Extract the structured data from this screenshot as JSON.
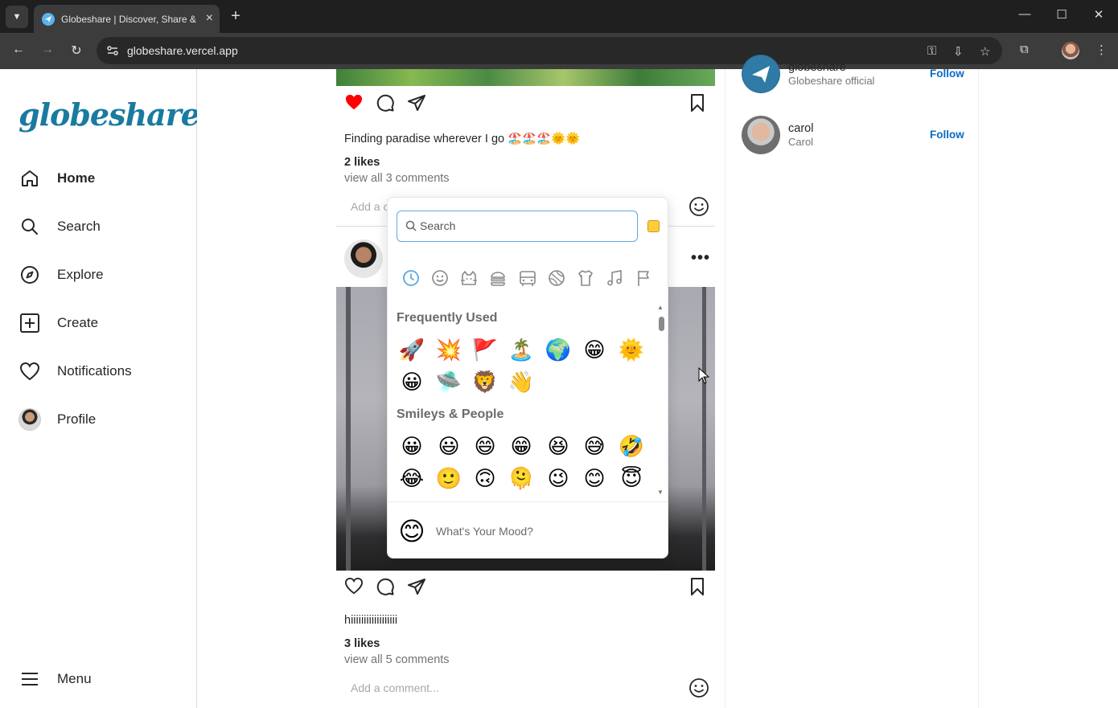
{
  "browser": {
    "tab_title": "Globeshare | Discover, Share & Connect",
    "url": "globeshare.vercel.app"
  },
  "sidebar": {
    "logo": "globeshare",
    "items": [
      {
        "label": "Home",
        "icon": "home-icon"
      },
      {
        "label": "Search",
        "icon": "search-icon"
      },
      {
        "label": "Explore",
        "icon": "compass-icon"
      },
      {
        "label": "Create",
        "icon": "plus-square-icon"
      },
      {
        "label": "Notifications",
        "icon": "heart-icon"
      },
      {
        "label": "Profile",
        "icon": "avatar"
      }
    ],
    "menu_label": "Menu"
  },
  "post1": {
    "caption": "Finding paradise wherever I go 🏖️🏖️🏖️🌞🌞",
    "likes": "2 likes",
    "comments_link": "view all 3 comments",
    "add_comment_placeholder": "Add a comment..."
  },
  "post2": {
    "caption": "hiiiiiiiiiiiiiiiiii",
    "likes": "3 likes",
    "comments_link": "view all 5 comments",
    "add_comment_placeholder": "Add a comment..."
  },
  "suggestions": [
    {
      "name": "globeshare",
      "sub": "Globeshare official",
      "follow": "Follow"
    },
    {
      "name": "carol",
      "sub": "Carol",
      "follow": "Follow"
    }
  ],
  "emoji_picker": {
    "search_placeholder": "Search",
    "categories": [
      "recent-icon",
      "smiley-icon",
      "animal-icon",
      "food-icon",
      "travel-icon",
      "activity-icon",
      "objects-icon",
      "symbols-icon",
      "flags-icon"
    ],
    "sections": [
      {
        "title": "Frequently Used",
        "emojis": [
          "🚀",
          "💥",
          "🚩",
          "🏝️",
          "🌍",
          "😁",
          "🌞",
          "😀",
          "🛸",
          "🦁",
          "👋"
        ]
      },
      {
        "title": "Smileys & People",
        "emojis": [
          "😀",
          "😃",
          "😄",
          "😁",
          "😆",
          "😅",
          "🤣",
          "😂",
          "🙂",
          "🙃",
          "🫠",
          "😉",
          "😊",
          "😇"
        ]
      }
    ],
    "preview_emoji": "😊",
    "preview_text": "What's Your Mood?",
    "skin_tone_color": "#ffcd3c"
  },
  "colors": {
    "accent": "#0b6bc4",
    "like_red": "#ff0000",
    "logo_dark": "#1a7aa0",
    "logo_light": "#5fb6d8"
  }
}
